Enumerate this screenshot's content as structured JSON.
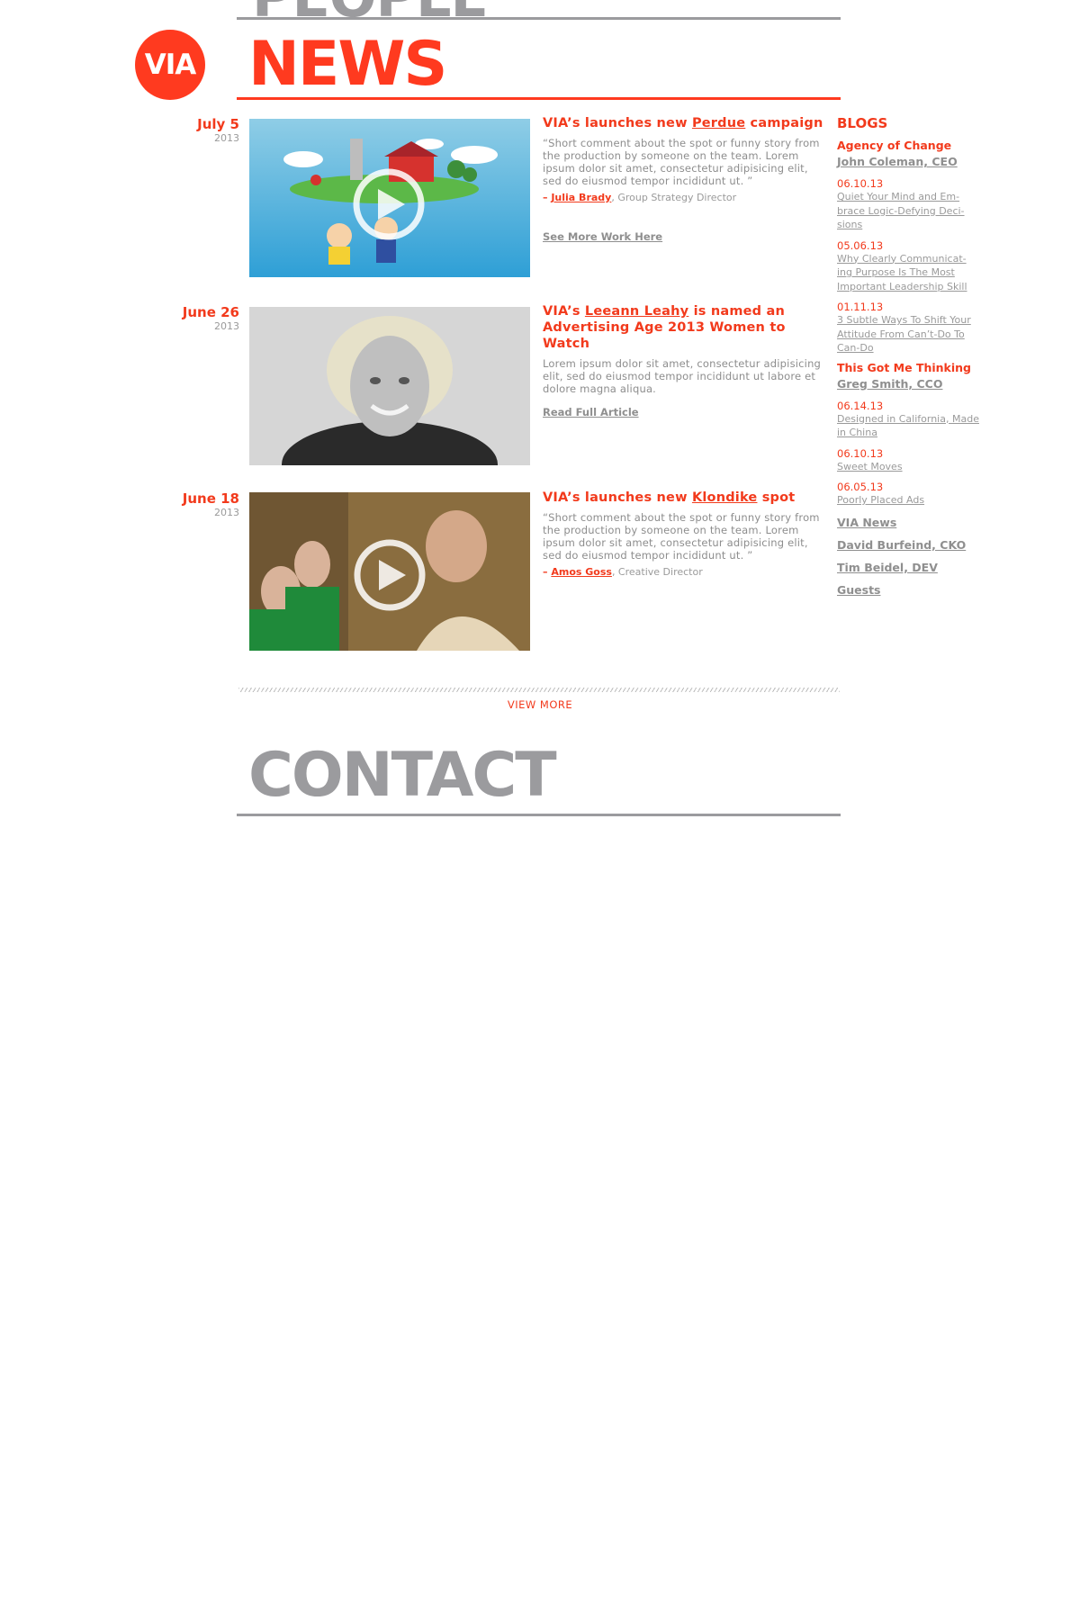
{
  "sections": {
    "people_title": "PEOPLE",
    "news_title": "NEWS",
    "contact_title": "CONTACT"
  },
  "logo": {
    "text": "VIA"
  },
  "colors": {
    "accent": "#ff3a1f",
    "gray": "#9b9b9e"
  },
  "news": [
    {
      "date": "July 5",
      "year": "2013",
      "headline_pre": "VIA’s launches new ",
      "headline_link": "Perdue",
      "headline_post": " campaign",
      "quote": "“Short comment about the spot or funny story from the production by someone on the team. Lorem ipsum dolor sit amet, consectetur adipisicing elit, sed do eiusmod tempor incididunt ut. ”",
      "attrib_dash": "– ",
      "attrib_name": "Julia Brady",
      "attrib_role": ", Group Strategy Director",
      "more_link": "See More Work Here",
      "thumb": "video-animated-farm"
    },
    {
      "date": "June 26",
      "year": "2013",
      "headline_pre": "VIA’s ",
      "headline_link": "Leeann Leahy",
      "headline_post": " is named an Advertising Age 2013 Women to Watch",
      "body": "Lorem ipsum dolor sit amet, consectetur adipisicing elit, sed do eiusmod tempor incididunt ut labore et dolore magna aliqua.",
      "more_link": "Read Full Article",
      "thumb": "photo-portrait-bw"
    },
    {
      "date": "June 18",
      "year": "2013",
      "headline_pre": "VIA’s launches new ",
      "headline_link": "Klondike",
      "headline_post": " spot",
      "quote": "“Short comment about the spot or funny story from the production by someone on the team. Lorem ipsum dolor sit amet, consectetur adipisicing elit, sed do eiusmod tempor incididunt ut. ”",
      "attrib_dash": "– ",
      "attrib_name": "Amos Goss",
      "attrib_role": ", Creative Director",
      "thumb": "video-klondike-scene"
    }
  ],
  "view_more": "VIEW MORE",
  "sidebar": {
    "heading": "BLOGS",
    "blog1": {
      "title": "Agency of Change",
      "author": "John Coleman, CEO",
      "posts": [
        {
          "date": "06.10.13",
          "title": "Quiet Your Mind and Em- brace Logic-Defying Deci- sions"
        },
        {
          "date": "05.06.13",
          "title": "Why Clearly Communicat- ing Purpose Is The Most Important Leadership Skill"
        },
        {
          "date": "01.11.13",
          "title": "3 Subtle Ways To Shift Your Attitude From Can’t-Do To Can-Do"
        }
      ]
    },
    "blog2": {
      "title": "This Got Me Thinking",
      "author": "Greg Smith, CCO",
      "posts": [
        {
          "date": "06.14.13",
          "title": "Designed in California, Made in China"
        },
        {
          "date": "06.10.13",
          "title": "Sweet Moves"
        },
        {
          "date": "06.05.13",
          "title": "Poorly Placed Ads"
        }
      ]
    },
    "links": [
      "VIA News",
      "David Burfeind, CKO",
      "Tim Beidel, DEV",
      "Guests"
    ]
  }
}
